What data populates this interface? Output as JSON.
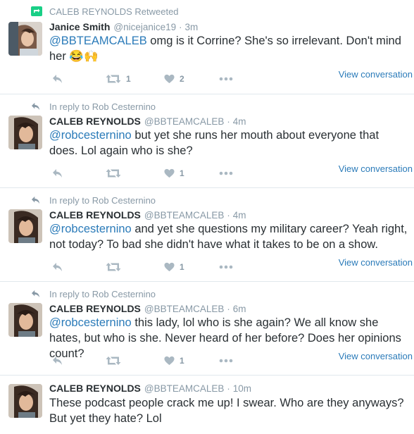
{
  "colors": {
    "link": "#2b7bb9",
    "muted": "#8899a6",
    "text": "#292f33",
    "retweet_green": "#19cf86",
    "divider": "#e1e8ed"
  },
  "tweets": [
    {
      "context_icon": "retweet-icon",
      "context": "CALEB REYNOLDS Retweeted",
      "name": "Janice Smith",
      "handle": "@nicejanice19",
      "dot": "·",
      "time": "3m",
      "mention": "@BBTEAMCALEB",
      "text": " omg is it Corrine? She's  so irrelevant. Don't mind her 😂🙌",
      "retweets": "1",
      "likes": "2",
      "view_conversation": "View conversation"
    },
    {
      "context_icon": "reply-icon",
      "context": "In reply to Rob Cesternino",
      "name": "CALEB REYNOLDS",
      "handle": "@BBTEAMCALEB",
      "dot": "·",
      "time": "4m",
      "mention": "@robcesternino",
      "text": " but yet she runs her mouth about everyone that does. Lol again who is she?",
      "retweets": "",
      "likes": "1",
      "view_conversation": "View conversation"
    },
    {
      "context_icon": "reply-icon",
      "context": "In reply to Rob Cesternino",
      "name": "CALEB REYNOLDS",
      "handle": "@BBTEAMCALEB",
      "dot": "·",
      "time": "4m",
      "mention": "@robcesternino",
      "text": " and yet she questions my military career? Yeah right, not today? To bad she didn't have what it takes to be on a show.",
      "retweets": "",
      "likes": "1",
      "view_conversation": "View conversation"
    },
    {
      "context_icon": "reply-icon",
      "context": "In reply to Rob Cesternino",
      "name": "CALEB REYNOLDS",
      "handle": "@BBTEAMCALEB",
      "dot": "·",
      "time": "6m",
      "mention": "@robcesternino",
      "text": " this lady, lol who is she again? We all know she hates, but who is she. Never heard of her before? Does her opinions count?",
      "retweets": "",
      "likes": "1",
      "view_conversation": "View conversation"
    },
    {
      "name": "CALEB REYNOLDS",
      "handle": "@BBTEAMCALEB",
      "dot": "·",
      "time": "10m",
      "mention": "",
      "text": "These podcast people crack me up! I swear. Who are they anyways? But yet they hate? Lol"
    }
  ]
}
